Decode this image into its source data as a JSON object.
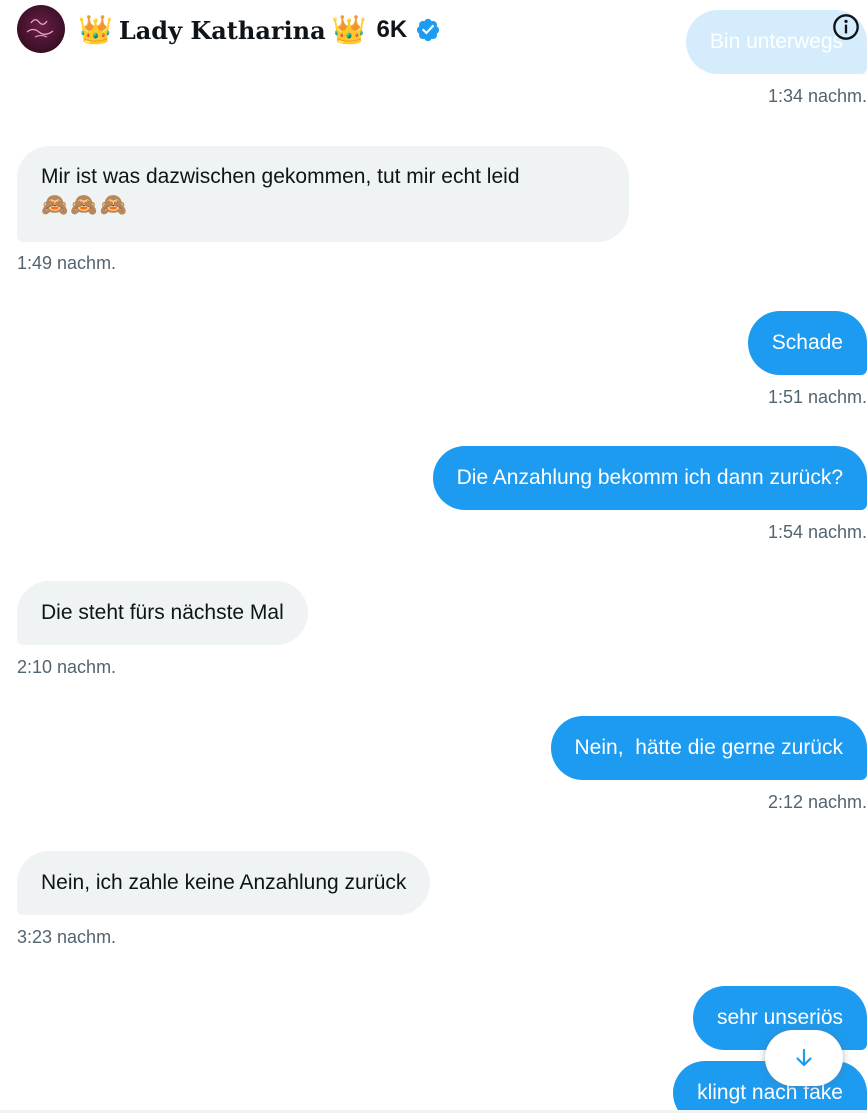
{
  "header": {
    "crown_left": "👑",
    "name": "𝐋𝐚𝐝𝐲 𝐊𝐚𝐭𝐡𝐚𝐫𝐢𝐧𝐚",
    "crown_right": "👑",
    "follower_count": "6K",
    "avatar_text": "Lady Katharina",
    "verified_icon": "verified-badge-icon",
    "info_icon": "info-icon"
  },
  "colors": {
    "accent": "#1d9bf0",
    "incoming_bubble": "#eff3f4",
    "timestamp": "#536471",
    "text": "#0f1419"
  },
  "messages": [
    {
      "direction": "out",
      "text": "Bin unterwegs",
      "time": "1:34 nachm."
    },
    {
      "direction": "in",
      "text": "Mir ist was dazwischen gekommen, tut mir echt leid",
      "emoji": "🙈🙈🙈",
      "time": "1:49 nachm."
    },
    {
      "direction": "out",
      "text": "Schade",
      "time": "1:51 nachm."
    },
    {
      "direction": "out",
      "text": "Die Anzahlung bekomm ich dann zurück?",
      "time": "1:54 nachm."
    },
    {
      "direction": "in",
      "text": "Die steht fürs nächste Mal",
      "time": "2:10 nachm."
    },
    {
      "direction": "out",
      "text": "Nein,  hätte die gerne zurück",
      "time": "2:12 nachm."
    },
    {
      "direction": "in",
      "text": "Nein, ich zahle keine Anzahlung zurück",
      "time": "3:23 nachm."
    },
    {
      "direction": "out",
      "text": "sehr unseriös"
    },
    {
      "direction": "out",
      "text": "klingt nach fake"
    }
  ],
  "scroll_button": {
    "icon": "arrow-down-icon"
  }
}
